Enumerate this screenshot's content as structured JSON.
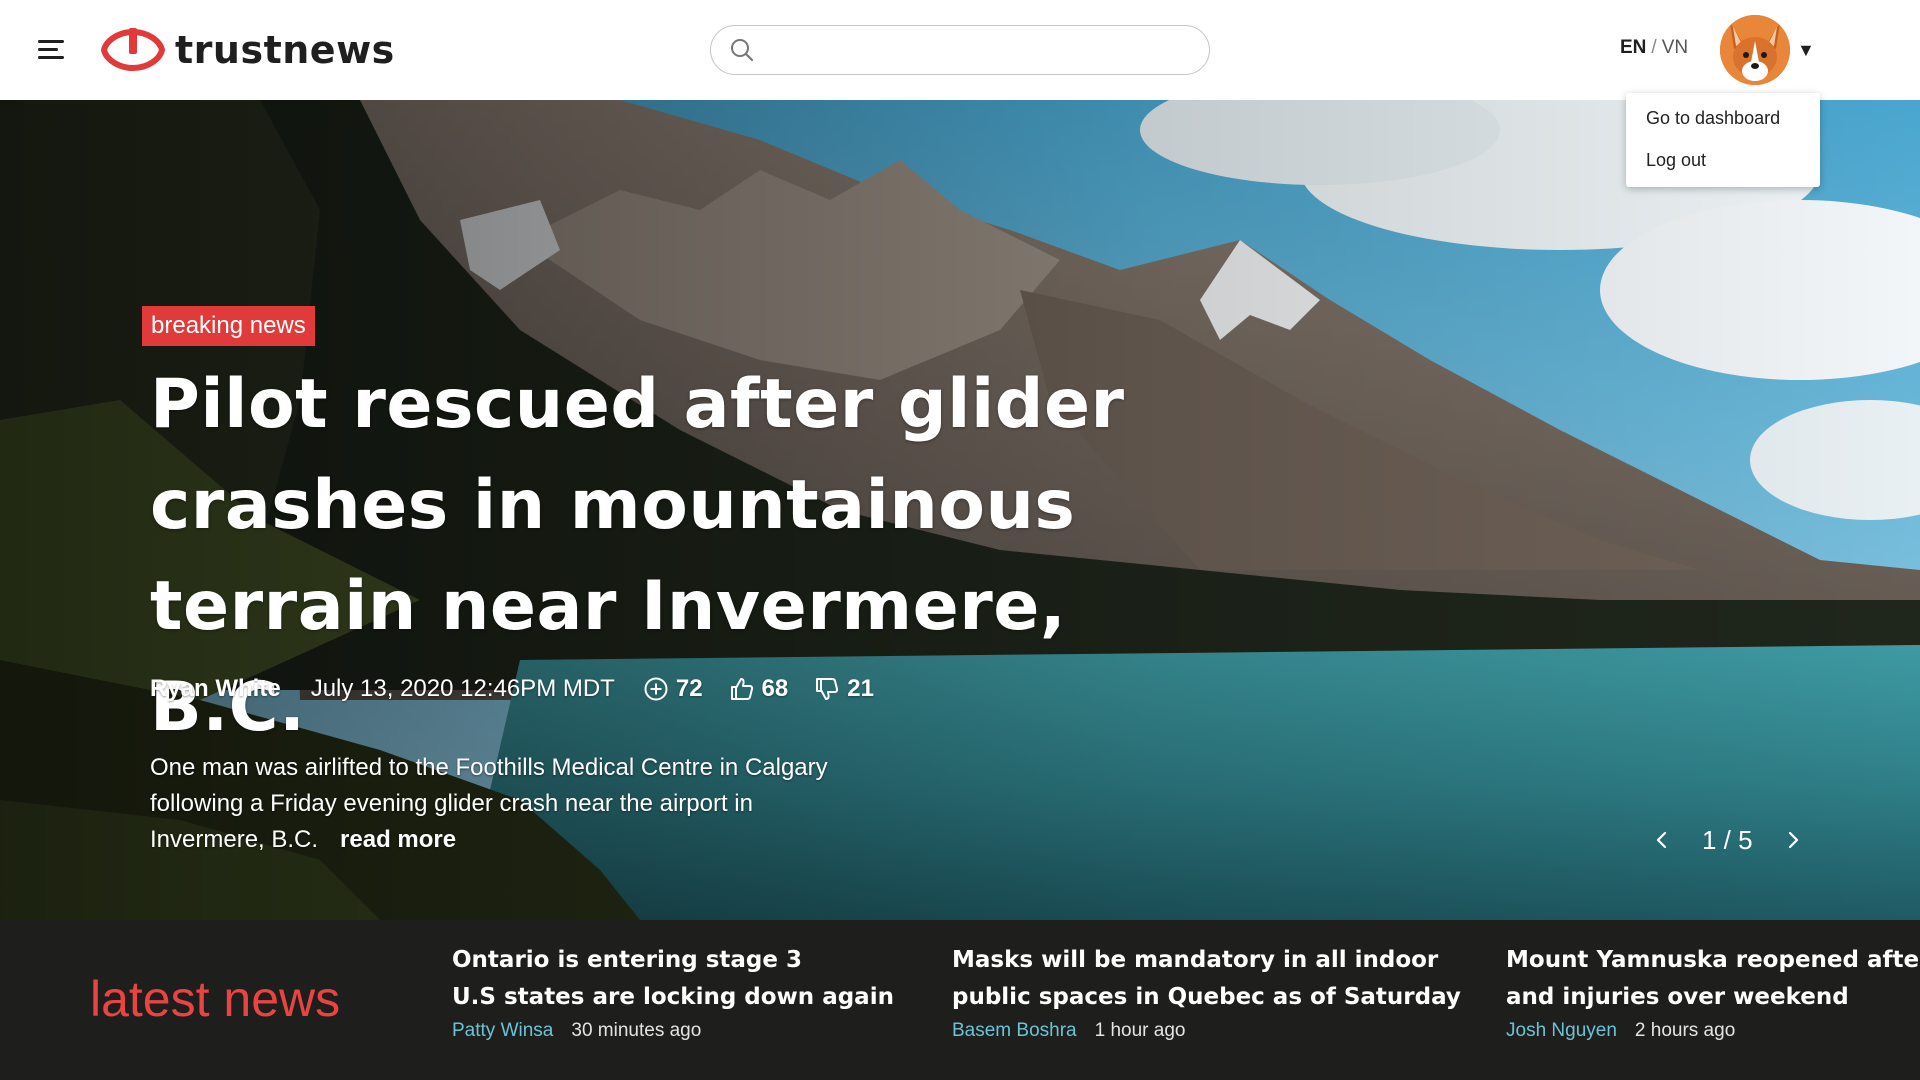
{
  "header": {
    "logo_text": "trustnews",
    "search": {
      "placeholder": "",
      "value": ""
    },
    "language": {
      "active": "EN",
      "separator": "/",
      "other": "VN"
    },
    "user_menu": {
      "items": [
        {
          "label": "Go to dashboard"
        },
        {
          "label": "Log out"
        }
      ]
    }
  },
  "hero": {
    "badge": "breaking news",
    "headline_lines": [
      "Pilot rescued after glider",
      "crashes in mountainous",
      "terrain near Invermere, B.C."
    ],
    "author": "Ryan White",
    "date": "July 13, 2020 12:46PM MDT",
    "stats": {
      "added": "72",
      "likes": "68",
      "dislikes": "21"
    },
    "summary": "One man was airlifted to the Foothills Medical Centre in Calgary following a Friday evening glider crash near the airport in Invermere, B.C.",
    "read_more": "read more",
    "slide_counter": "1 / 5"
  },
  "latest": {
    "title": "latest news",
    "items": [
      {
        "lines": [
          "Ontario is entering stage 3",
          "U.S states are locking down again"
        ],
        "author": "Patty Winsa",
        "time": "30 minutes ago"
      },
      {
        "lines": [
          "Masks will be mandatory in all indoor",
          "public spaces in Quebec as of Saturday"
        ],
        "author": "Basem Boshra",
        "time": "1 hour ago"
      },
      {
        "lines": [
          "Mount Yamnuska reopened after deaths",
          "and injuries over weekend"
        ],
        "author": "Josh Nguyen",
        "time": "2 hours ago"
      }
    ]
  },
  "colors": {
    "brand_red": "#e03a3a",
    "latest_bg": "#1e1e1c",
    "author_link": "#6ac4d8"
  },
  "icons": [
    "menu-icon",
    "logo-icon",
    "search-icon",
    "caret-down-icon",
    "plus-circle-icon",
    "thumbs-up-icon",
    "thumbs-down-icon",
    "chevron-left-icon",
    "chevron-right-icon"
  ]
}
